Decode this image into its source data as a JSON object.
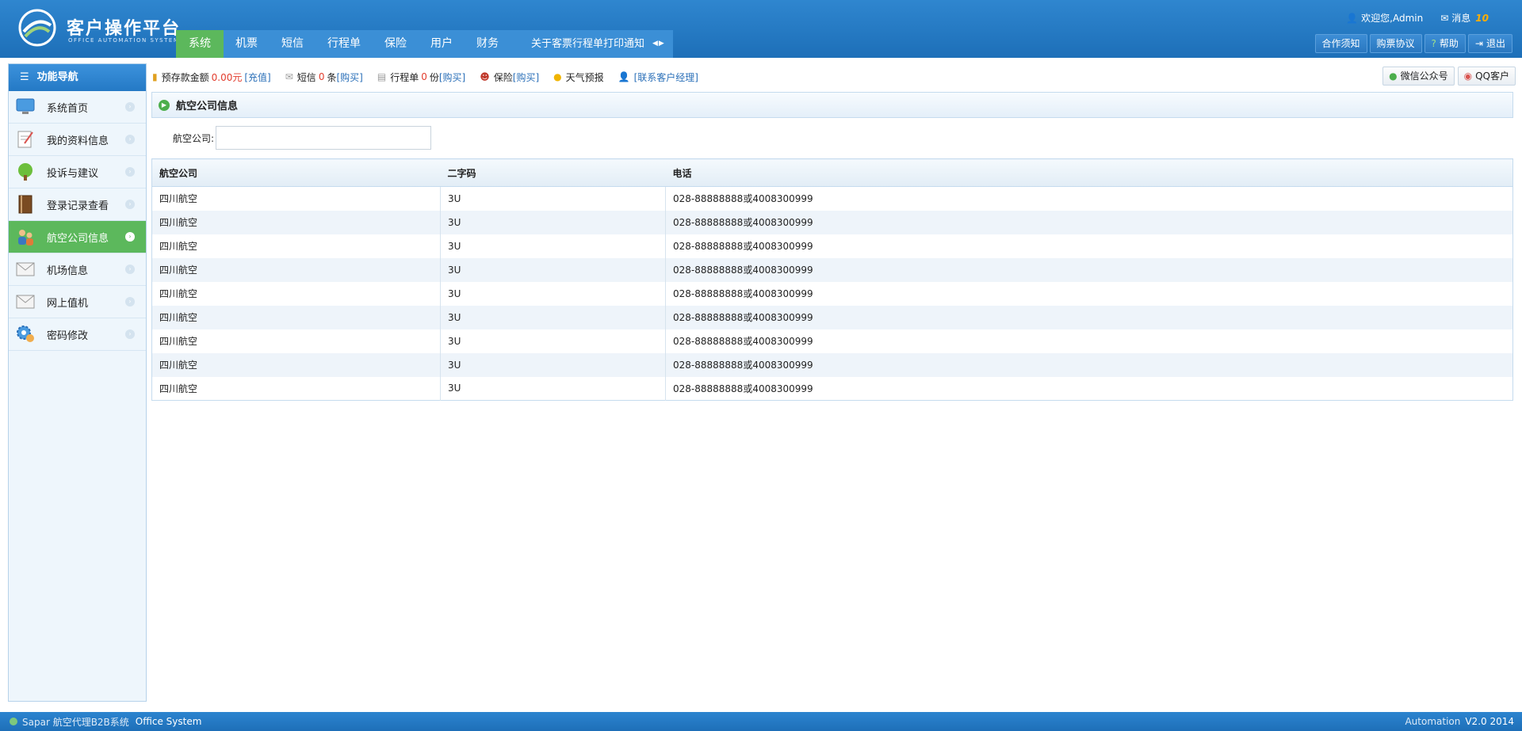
{
  "header": {
    "title": "客户操作平台",
    "subtitle": "OFFICE AUTOMATION SYSTEM",
    "nav": [
      "系统",
      "机票",
      "短信",
      "行程单",
      "保险",
      "用户",
      "财务"
    ],
    "notice": "关于客票行程单打印通知",
    "user_welcome": "欢迎您,Admin",
    "messages_label": "消息",
    "messages_count": "10",
    "buttons": [
      "合作须知",
      "购票协议",
      "帮助",
      "退出"
    ]
  },
  "sidebar": {
    "title": "功能导航",
    "items": [
      {
        "label": "系统首页",
        "icon": "monitor-icon"
      },
      {
        "label": "我的资料信息",
        "icon": "notepad-icon"
      },
      {
        "label": "投诉与建议",
        "icon": "tree-icon"
      },
      {
        "label": "登录记录查看",
        "icon": "book-icon"
      },
      {
        "label": "航空公司信息",
        "icon": "users-icon"
      },
      {
        "label": "机场信息",
        "icon": "mail-icon"
      },
      {
        "label": "网上值机",
        "icon": "mail-icon"
      },
      {
        "label": "密码修改",
        "icon": "gear-icon"
      }
    ]
  },
  "toolbar": {
    "deposit_label": "预存款金额",
    "deposit_value": "0.00元",
    "recharge": "[充值]",
    "sms_label": "短信",
    "sms_count": "0",
    "sms_unit": "条",
    "sms_buy": "[购买]",
    "itinerary_label": "行程单",
    "itinerary_count": "0",
    "itinerary_unit": "份",
    "itinerary_buy": "[购买]",
    "insurance_label": "保险",
    "insurance_buy": "[购买]",
    "weather": "天气预报",
    "contact": "[联系客户经理]",
    "wechat": "微信公众号",
    "qq": "QQ客户"
  },
  "panel": {
    "title": "航空公司信息",
    "filter_label": "航空公司:",
    "filter_value": ""
  },
  "table": {
    "headers": [
      "航空公司",
      "二字码",
      "电话"
    ],
    "rows": [
      [
        "四川航空",
        "3U",
        "028-88888888或4008300999"
      ],
      [
        "四川航空",
        "3U",
        "028-88888888或4008300999"
      ],
      [
        "四川航空",
        "3U",
        "028-88888888或4008300999"
      ],
      [
        "四川航空",
        "3U",
        "028-88888888或4008300999"
      ],
      [
        "四川航空",
        "3U",
        "028-88888888或4008300999"
      ],
      [
        "四川航空",
        "3U",
        "028-88888888或4008300999"
      ],
      [
        "四川航空",
        "3U",
        "028-88888888或4008300999"
      ],
      [
        "四川航空",
        "3U",
        "028-88888888或4008300999"
      ],
      [
        "四川航空",
        "3U",
        "028-88888888或4008300999"
      ]
    ]
  },
  "footer": {
    "left": "Sapar 航空代理B2B系统",
    "system": "Office System",
    "right_label": "Automation",
    "version": "V2.0 2014"
  },
  "colors": {
    "header_blue": "#2f86cf",
    "active_green": "#5cb85c",
    "amount_red": "#e23c2d",
    "link_blue": "#2a6fb8"
  }
}
